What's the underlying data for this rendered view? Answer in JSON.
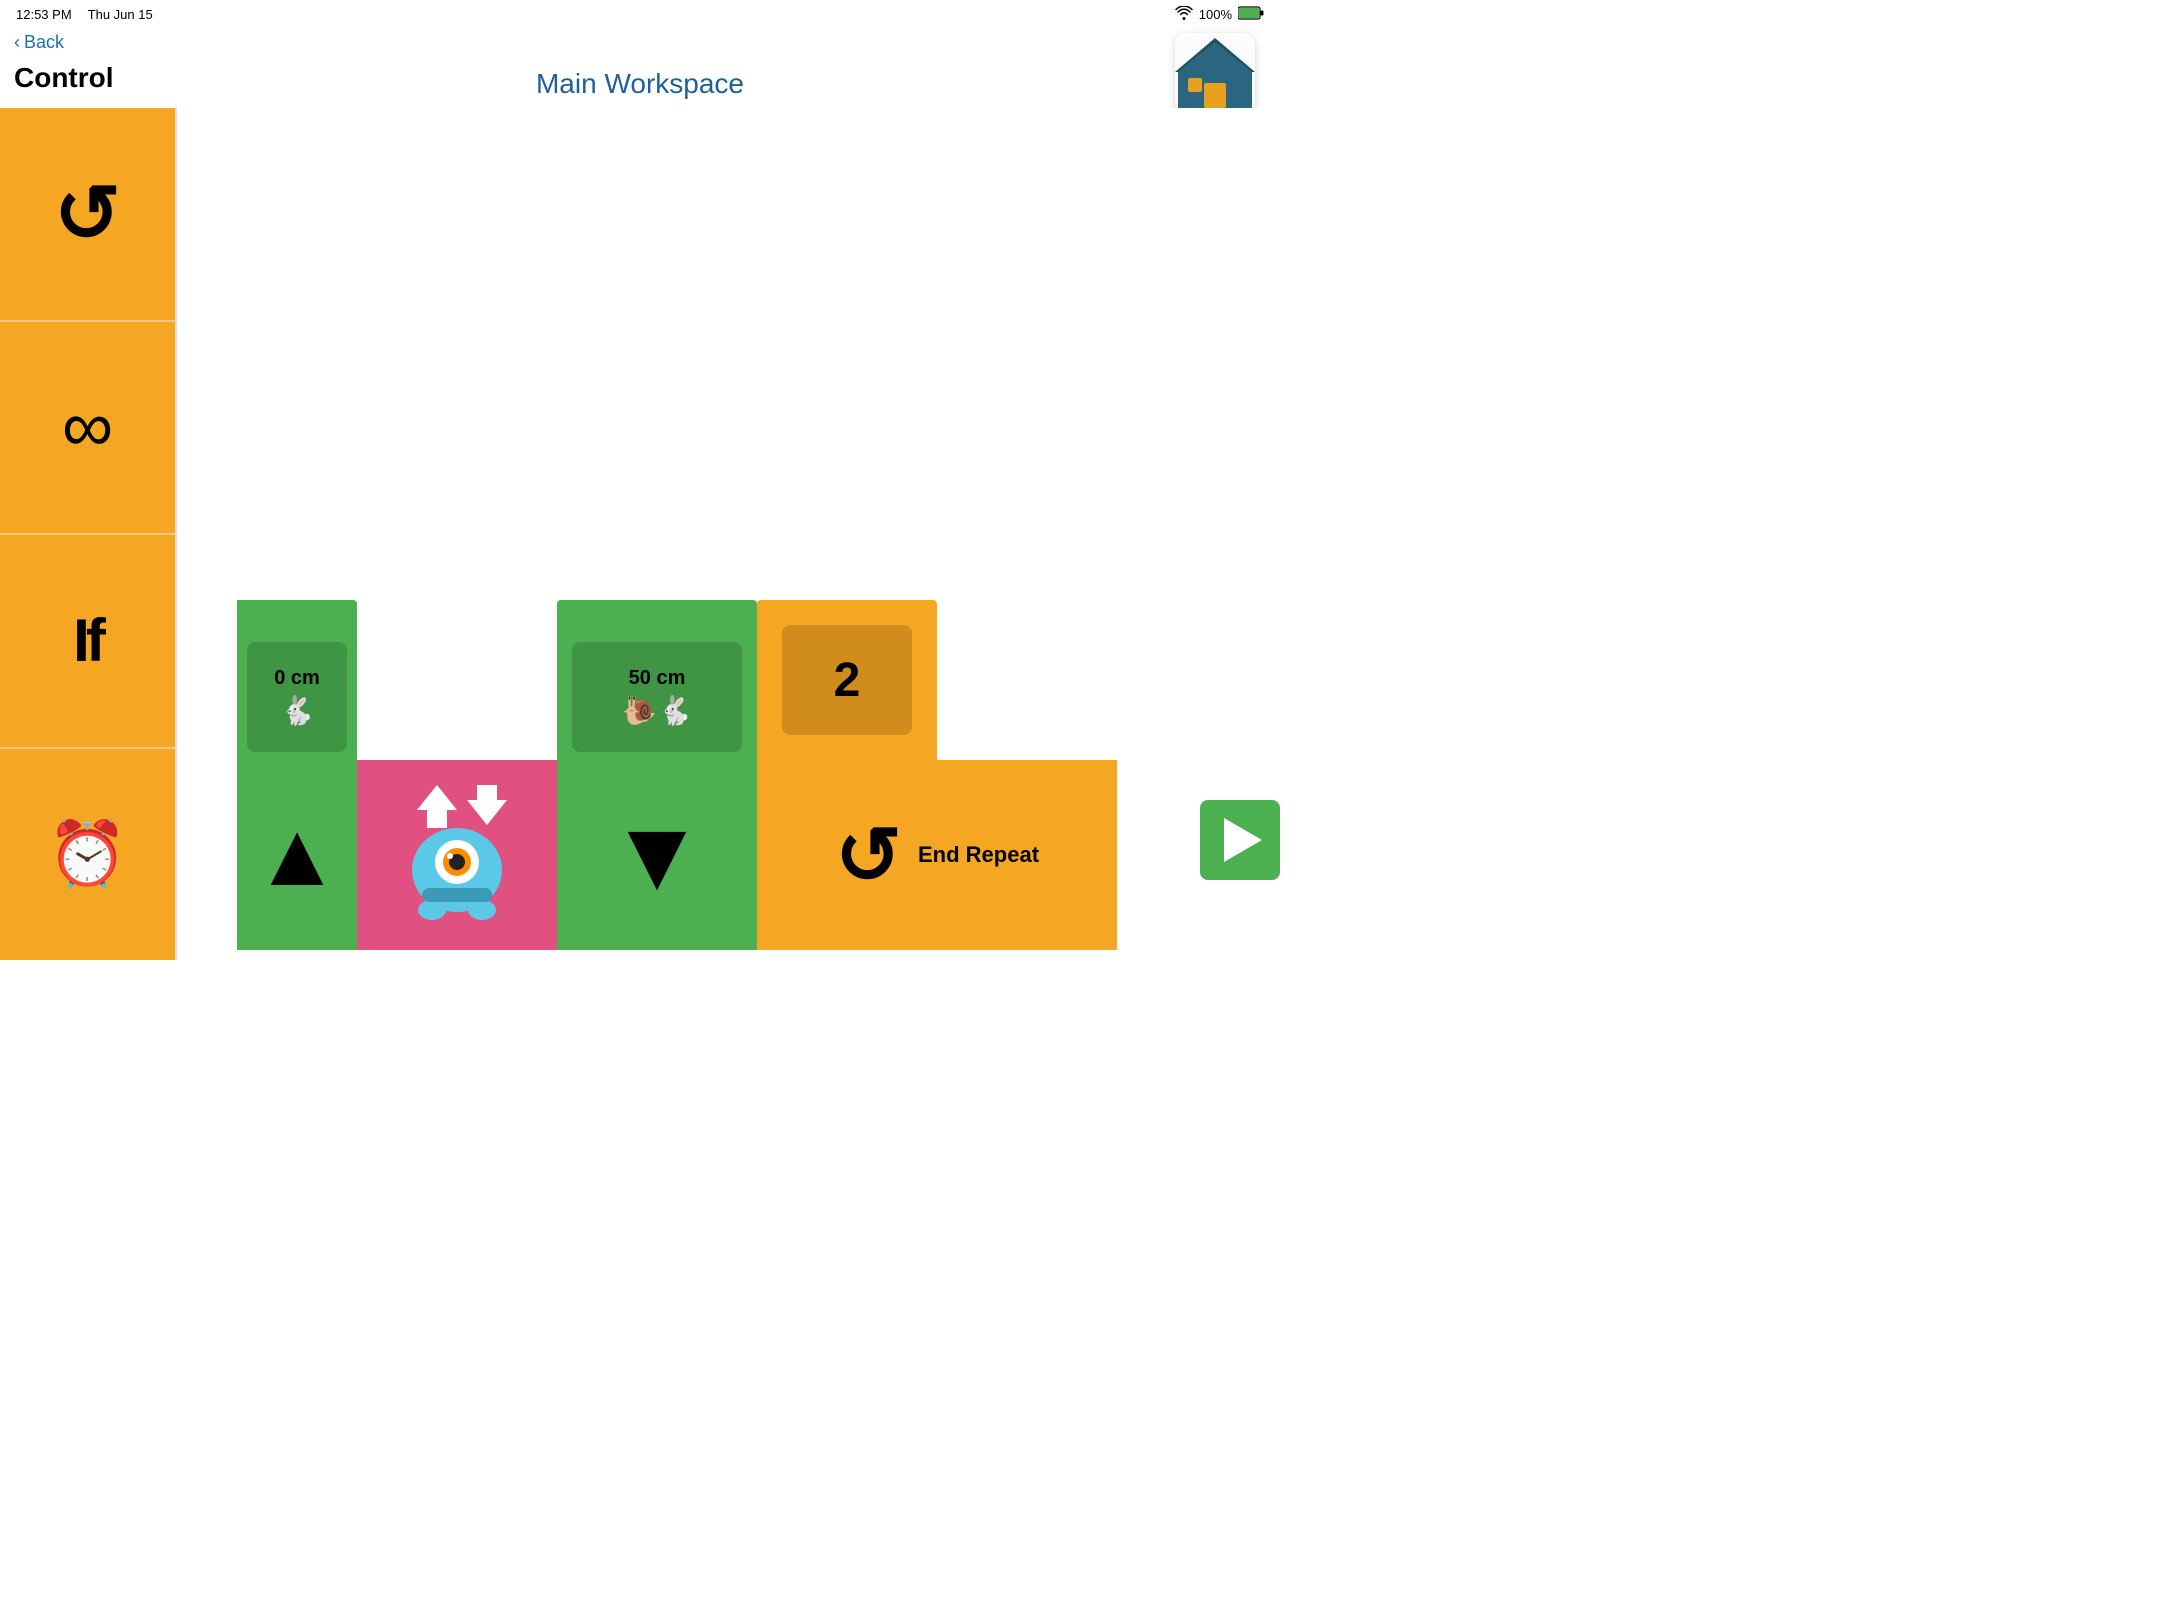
{
  "statusBar": {
    "time": "12:53 PM",
    "date": "Thu Jun 15",
    "wifi": "WiFi",
    "battery": "100%"
  },
  "navigation": {
    "backLabel": "Back"
  },
  "header": {
    "controlLabel": "Control",
    "workspaceTitle": "Main Workspace"
  },
  "sidebar": {
    "items": [
      {
        "id": "repeat",
        "icon": "↻",
        "label": "Repeat"
      },
      {
        "id": "forever",
        "icon": "∞",
        "label": "Forever"
      },
      {
        "id": "if",
        "icon": "If",
        "label": "If"
      },
      {
        "id": "timer",
        "icon": "⏰",
        "label": "Timer"
      }
    ]
  },
  "blocks": {
    "move1": {
      "distance": "0 cm",
      "speed": "fast"
    },
    "move2": {
      "distance": "50 cm",
      "speed": "slow"
    },
    "repeatCount": "2",
    "endRepeatLabel": "End Repeat"
  },
  "playButton": {
    "label": "Play"
  }
}
